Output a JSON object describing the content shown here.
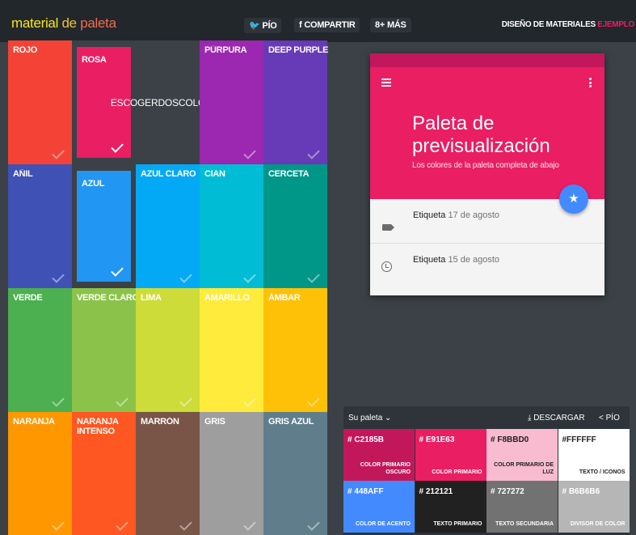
{
  "header": {
    "brand": [
      "material",
      " de ",
      "paleta"
    ],
    "tweet": "PÍO",
    "share": "COMPARTIR",
    "more": "MÁS",
    "design": "DISEÑO DE MATERIALES",
    "examples": "EJEMPLO"
  },
  "grid": [
    {
      "label": "ROJO",
      "color": "#F44336"
    },
    {
      "label": "ROSA",
      "color": "#E91E63",
      "selected": true
    },
    {
      "label": "ESCOGER DOS COLORES",
      "special": true
    },
    {
      "label": "PÚRPURA",
      "color": "#9C27B0"
    },
    {
      "label": "DEEP PURPLE",
      "color": "#673AB7"
    },
    {
      "label": "AÑIL",
      "color": "#3F51B5"
    },
    {
      "label": "AZUL",
      "color": "#2196F3",
      "selected": true
    },
    {
      "label": "AZUL CLARO",
      "color": "#03A9F4"
    },
    {
      "label": "CIAN",
      "color": "#00BCD4"
    },
    {
      "label": "CERCETA",
      "color": "#009688"
    },
    {
      "label": "VERDE",
      "color": "#4CAF50"
    },
    {
      "label": "VERDE CLARO",
      "color": "#8BC34A"
    },
    {
      "label": "LIMA",
      "color": "#CDDC39"
    },
    {
      "label": "AMARILLO",
      "color": "#FFEB3B"
    },
    {
      "label": "ÁMBAR",
      "color": "#FFC107"
    },
    {
      "label": "NARANJA",
      "color": "#FF9800"
    },
    {
      "label": "NARANJA INTENSO",
      "color": "#FF5722"
    },
    {
      "label": "MARRÓN",
      "color": "#795548"
    },
    {
      "label": "GRIS",
      "color": "#9E9E9E"
    },
    {
      "label": "GRIS AZUL",
      "color": "#607D8B"
    }
  ],
  "escoger": [
    "ESCOGER",
    "DOS",
    "COLORES"
  ],
  "preview": {
    "title": "Paleta de previsualización",
    "subtitle": "Los colores de la paleta completa de abajo",
    "rows": [
      {
        "label": "Etiqueta",
        "date": "17 de agosto",
        "icon": "label-icon"
      },
      {
        "label": "Etiqueta",
        "date": "15 de agosto",
        "icon": "clock-icon"
      }
    ]
  },
  "palette": {
    "title": "Su paleta",
    "download": "DESCARGAR",
    "tweet": "PÍO",
    "swatches": [
      {
        "hex": "# C2185B",
        "role": "COLOR PRIMARIO OSCURO",
        "color": "#C2185B",
        "light": false
      },
      {
        "hex": "# E91E63",
        "role": "COLOR PRIMARIO",
        "color": "#E91E63",
        "light": false
      },
      {
        "hex": "# F8BBD0",
        "role": "COLOR PRIMARIO DE LUZ",
        "color": "#F8BBD0",
        "light": true
      },
      {
        "hex": "#FFFFFF",
        "role": "TEXTO / ICONOS",
        "color": "#FFFFFF",
        "light": true
      },
      {
        "hex": "# 448AFF",
        "role": "COLOR DE ACENTO",
        "color": "#448AFF",
        "light": false
      },
      {
        "hex": "# 212121",
        "role": "TEXTO PRIMARIO",
        "color": "#212121",
        "light": false
      },
      {
        "hex": "# 727272",
        "role": "TEXTO SECUNDARIA",
        "color": "#727272",
        "light": false
      },
      {
        "hex": "# B6B6B6",
        "role": "DIVISOR DE COLOR",
        "color": "#B6B6B6",
        "light": false
      }
    ]
  }
}
